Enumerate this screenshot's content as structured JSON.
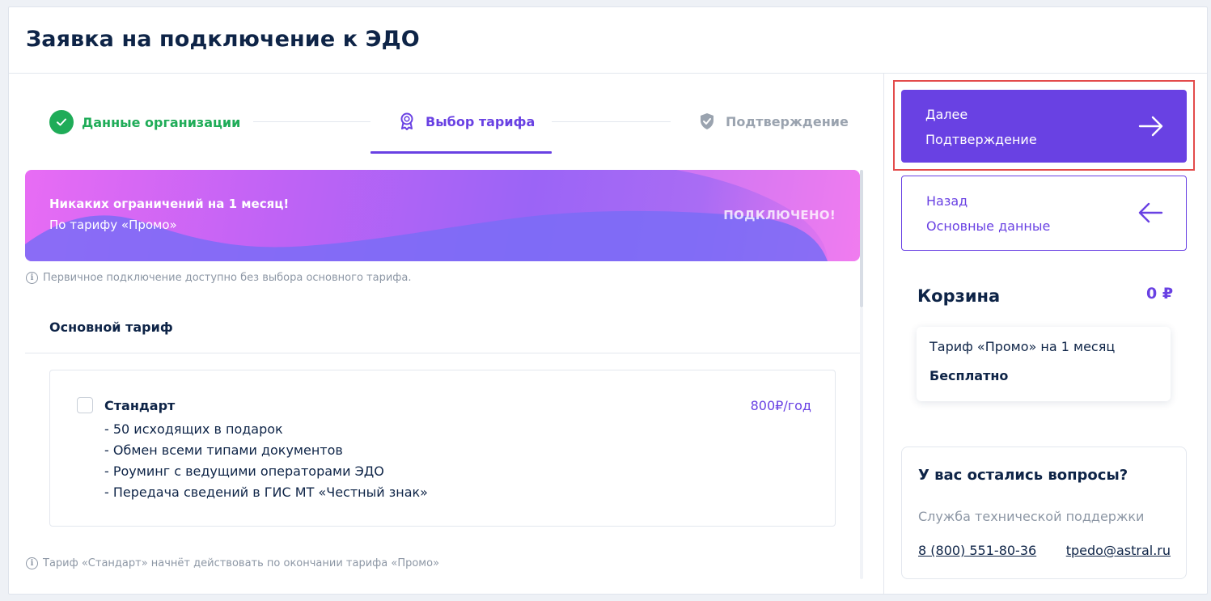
{
  "page": {
    "title": "Заявка на подключение к ЭДО"
  },
  "stepper": {
    "steps": [
      {
        "label": "Данные организации",
        "state": "done"
      },
      {
        "label": "Выбор тарифа",
        "state": "active"
      },
      {
        "label": "Подтверждение",
        "state": "pending"
      }
    ]
  },
  "promo": {
    "title": "Никаких ограничений на 1 месяц!",
    "subtitle": "По тарифу «Промо»",
    "status": "ПОДКЛЮЧЕНО!"
  },
  "info": {
    "initial": "Первичное подключение доступно без выбора основного тарифа.",
    "standard_note": "Тариф «Стандарт» начнёт действовать по окончании тарифа «Промо»"
  },
  "main_tariff": {
    "section_title": "Основной тариф",
    "option": {
      "name": "Стандарт",
      "price": "800₽/год",
      "checked": false,
      "features": [
        "- 50 исходящих в подарок",
        "- Обмен всеми типами документов",
        "- Роуминг с ведущими операторами ЭДО",
        "- Передача сведений в ГИС МТ «Честный знак»"
      ]
    }
  },
  "nav": {
    "next": {
      "label": "Далее",
      "target": "Подтверждение"
    },
    "back": {
      "label": "Назад",
      "target": "Основные данные"
    }
  },
  "cart": {
    "title": "Корзина",
    "total": "0 ₽",
    "item": {
      "name": "Тариф «Промо» на 1 месяц",
      "price": "Бесплатно"
    }
  },
  "help": {
    "title": "У вас остались вопросы?",
    "subtitle": "Служба технической поддержки",
    "phone": "8 (800) 551-80-36",
    "email": "tpedo@astral.ru"
  },
  "colors": {
    "accent": "#6941e3",
    "success": "#1fac58",
    "text": "#0e2447",
    "muted": "#8d97a5",
    "highlight": "#e34b4b"
  }
}
